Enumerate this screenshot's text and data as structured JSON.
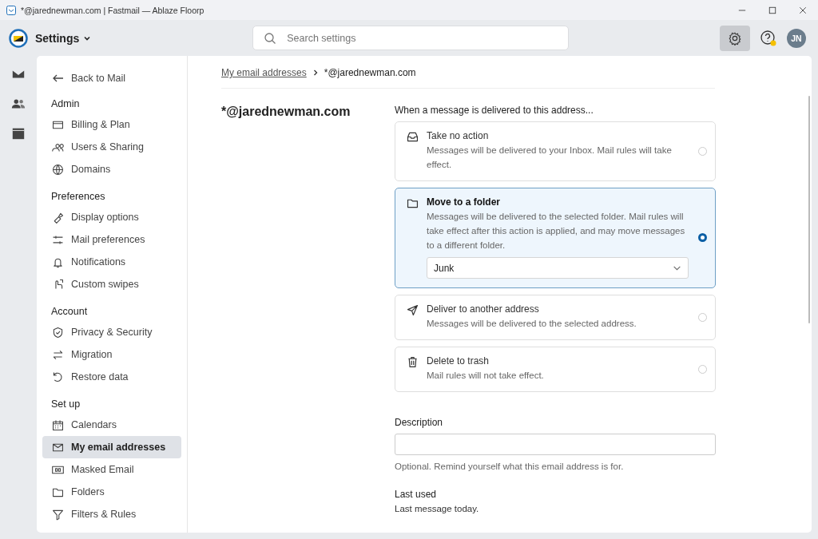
{
  "window": {
    "title": "*@jarednewman.com | Fastmail — Ablaze Floorp"
  },
  "header": {
    "app_title": "Settings",
    "search": {
      "placeholder": "Search settings"
    },
    "avatar": "JN",
    "help_notification": true
  },
  "sidebar": {
    "back": "Back to Mail",
    "sections": [
      {
        "heading": "Admin",
        "items": [
          {
            "label": "Billing & Plan",
            "selected": false
          },
          {
            "label": "Users & Sharing",
            "selected": false
          },
          {
            "label": "Domains",
            "selected": false
          }
        ]
      },
      {
        "heading": "Preferences",
        "items": [
          {
            "label": "Display options",
            "selected": false
          },
          {
            "label": "Mail preferences",
            "selected": false
          },
          {
            "label": "Notifications",
            "selected": false
          },
          {
            "label": "Custom swipes",
            "selected": false
          }
        ]
      },
      {
        "heading": "Account",
        "items": [
          {
            "label": "Privacy & Security",
            "selected": false
          },
          {
            "label": "Migration",
            "selected": false
          },
          {
            "label": "Restore data",
            "selected": false
          }
        ]
      },
      {
        "heading": "Set up",
        "items": [
          {
            "label": "Calendars",
            "selected": false
          },
          {
            "label": "My email addresses",
            "selected": true
          },
          {
            "label": "Masked Email",
            "selected": false
          },
          {
            "label": "Folders",
            "selected": false
          },
          {
            "label": "Filters & Rules",
            "selected": false
          }
        ]
      }
    ]
  },
  "breadcrumb": {
    "link": "My email addresses",
    "current": "*@jarednewman.com"
  },
  "address_title": "*@jarednewman.com",
  "delivery": {
    "heading": "When a message is delivered to this address...",
    "options": [
      {
        "title": "Take no action",
        "description": "Messages will be delivered to your Inbox. Mail rules will take effect.",
        "selected": false
      },
      {
        "title": "Move to a folder",
        "description": "Messages will be delivered to the selected folder. Mail rules will take effect after this action is applied, and may move messages to a different folder.",
        "selected": true,
        "folder": "Junk"
      },
      {
        "title": "Deliver to another address",
        "description": "Messages will be delivered to the selected address.",
        "selected": false
      },
      {
        "title": "Delete to trash",
        "description": "Mail rules will not take effect.",
        "selected": false
      }
    ]
  },
  "description": {
    "label": "Description",
    "hint": "Optional. Remind yourself what this email address is for."
  },
  "last_used": {
    "label": "Last used",
    "value": "Last message today."
  }
}
